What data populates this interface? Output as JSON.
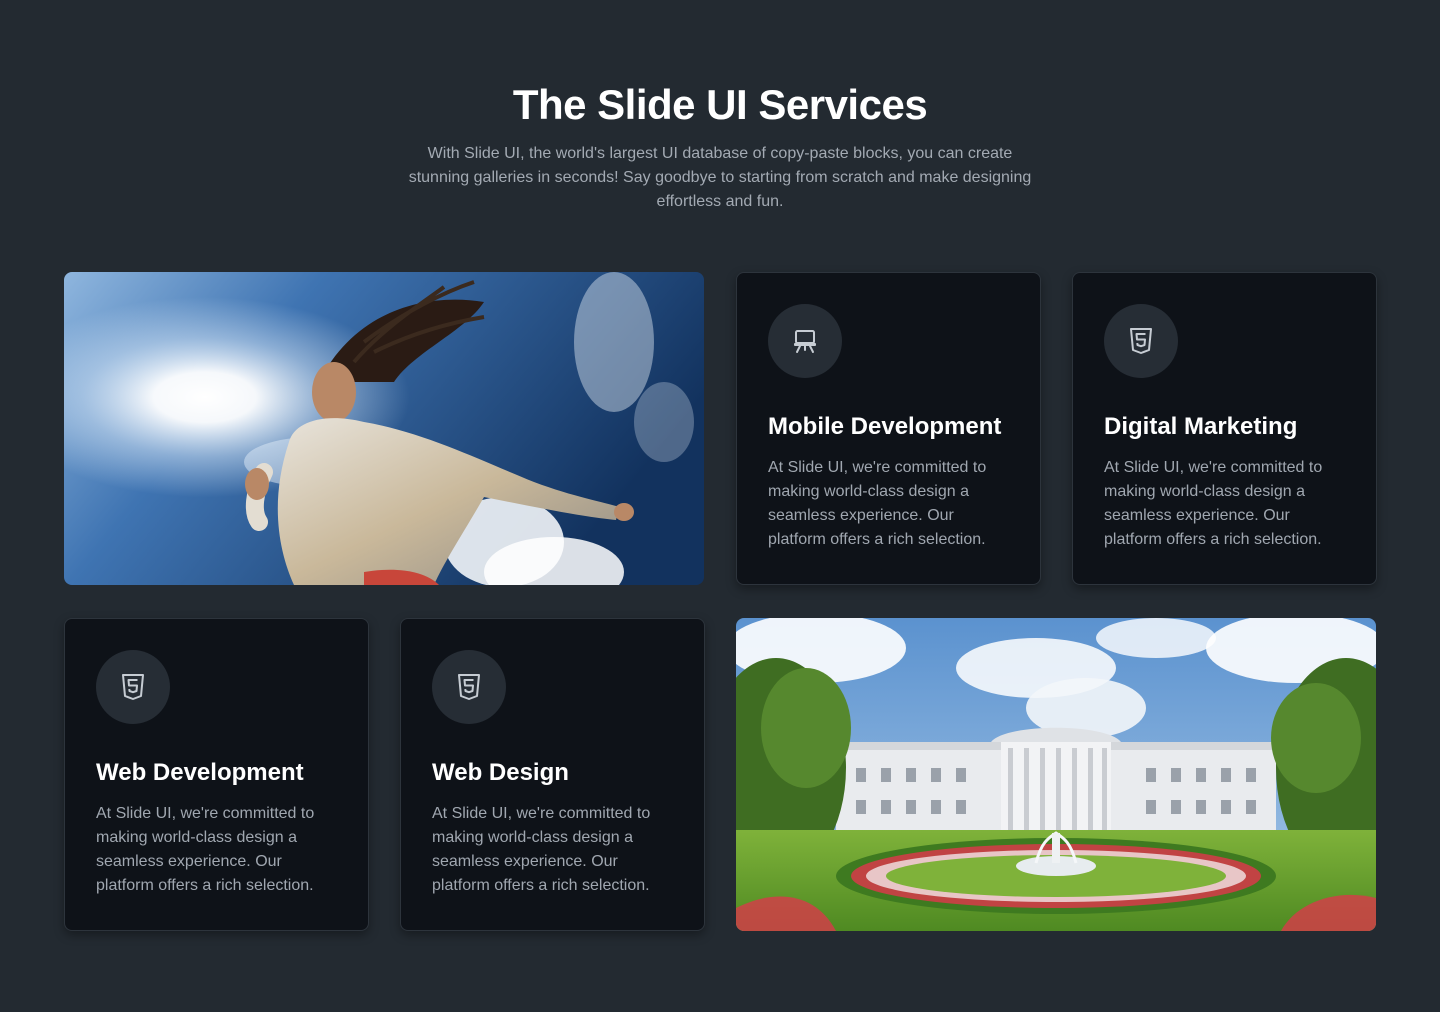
{
  "header": {
    "title": "The Slide UI Services",
    "subtitle": "With Slide UI, the world's largest UI database of copy-paste blocks, you can create stunning galleries in seconds! Say goodbye to starting from scratch and make designing effortless and fun."
  },
  "cards": [
    {
      "icon": "presentation-icon",
      "title": "Mobile Development",
      "text": "At Slide UI, we're committed to making world-class design a seamless experience. Our platform offers a rich selection."
    },
    {
      "icon": "html5-icon",
      "title": "Digital Marketing",
      "text": "At Slide UI, we're committed to making world-class design a seamless experience. Our platform offers a rich selection."
    },
    {
      "icon": "html5-icon",
      "title": "Web Development",
      "text": "At Slide UI, we're committed to making world-class design a seamless experience. Our platform offers a rich selection."
    },
    {
      "icon": "html5-icon",
      "title": "Web Design",
      "text": "At Slide UI, we're committed to making world-class design a seamless experience. Our platform offers a rich selection."
    }
  ],
  "images": [
    {
      "name": "runner-sky-image"
    },
    {
      "name": "white-house-garden-image"
    }
  ],
  "colors": {
    "background": "#232a31",
    "card": "#0e1218",
    "icon_circle": "#262d35",
    "title": "#ffffff",
    "body_text": "#a0a7b0"
  }
}
